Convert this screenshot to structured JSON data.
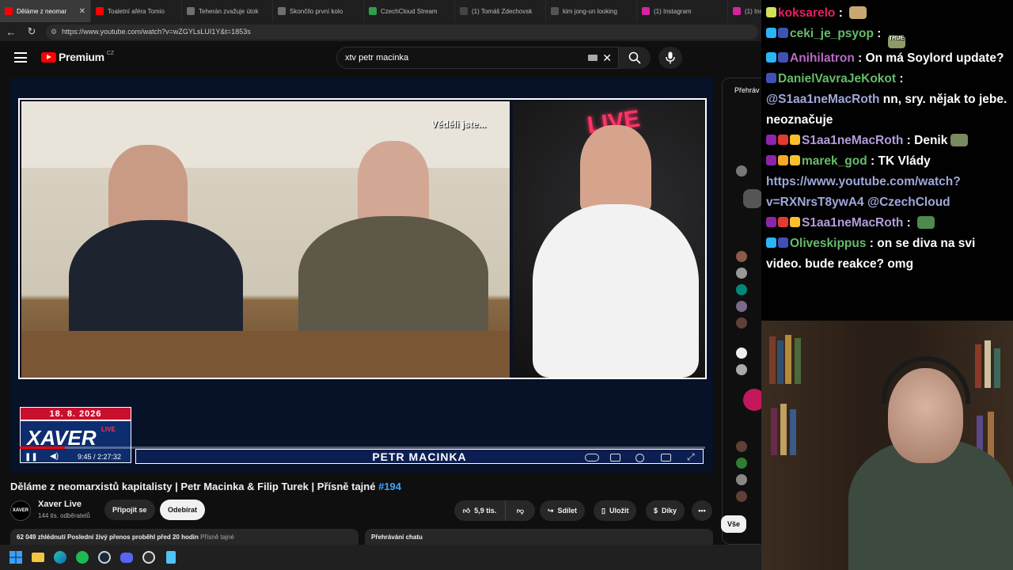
{
  "browser": {
    "tabs": [
      {
        "title": "Děláme z neomar",
        "active": true,
        "icon": "youtube-icon",
        "color": "#ff0000"
      },
      {
        "title": "Toaletní aféra Tomio",
        "active": false,
        "icon": "youtube-icon",
        "color": "#ff0000"
      },
      {
        "title": "Teherán zvažuje útok",
        "active": false,
        "icon": "page-icon",
        "color": "#6f6f6f"
      },
      {
        "title": "Skončilo první kolo",
        "active": false,
        "icon": "page-icon",
        "color": "#6f6f6f"
      },
      {
        "title": "CzechCloud Stream",
        "active": false,
        "icon": "green-icon",
        "color": "#2e9e4a"
      },
      {
        "title": "(1) Tomáš Zdechovsk",
        "active": false,
        "icon": "x-icon",
        "color": "#444444"
      },
      {
        "title": "kim jong-un looking",
        "active": false,
        "icon": "page-icon",
        "color": "#555555"
      },
      {
        "title": "(1) Instagram",
        "active": false,
        "icon": "instagram-icon",
        "color": "#d6249f"
      },
      {
        "title": "(1) Instag",
        "active": false,
        "icon": "instagram-icon",
        "color": "#d6249f"
      }
    ],
    "url": "https://www.youtube.com/watch?v=wZGYLsLUI1Y&t=1853s"
  },
  "youtube": {
    "logo_text": "Premium",
    "logo_region": "CZ",
    "search_value": "xtv petr macinka",
    "video": {
      "overlay_text": "Věděli jste...",
      "live_sign": "LIVE",
      "date": "18. 8. 2026",
      "brand": "XAVER",
      "brand_live": "LIVE",
      "time": "9:45 / 2:27:32",
      "name_bar": "PETR MACINKA",
      "progress": 0.066
    },
    "title": "Děláme z neomarxistů kapitalisty | Petr Macinka & Filip Turek | Přísně tajné",
    "title_tag": "#194",
    "channel": {
      "name": "Xaver Live",
      "subscribers": "144 tis. odběratelů",
      "avatar_text": "XAVER"
    },
    "buttons": {
      "join": "Připojit se",
      "unsubscribe": "Odebírat",
      "likes": "5,9 tis.",
      "share": "Sdílet",
      "save": "Uložit",
      "thanks": "Díky"
    },
    "description": {
      "views": "62 049 zhlédnutí",
      "stream_info": "Poslední živý přenos proběhl před 20 hodin",
      "tag": "Přísně tajné"
    },
    "chat_replay_label": "Přehrávání chatu",
    "side_header": "Přehráv",
    "side_filter": "Vše"
  },
  "twitch_chat": [
    {
      "user": "koksarelo",
      "color": "#e91e63",
      "text": "",
      "badges": [
        "#d4e157"
      ],
      "emote": "#c8a870"
    },
    {
      "user": "ceki_je_psyop",
      "color": "#66bb6a",
      "text": "",
      "badges": [
        "#29b6f6",
        "#3f51b5"
      ],
      "emote": "#8d9a6a",
      "emote_label": "TRUE"
    },
    {
      "user": "Anihilatron",
      "color": "#ba68c8",
      "text": "On má Soylord update?",
      "badges": [
        "#29b6f6",
        "#3f51b5"
      ]
    },
    {
      "user": "DanielVavraJeKokot",
      "color": "#66bb6a",
      "text": "",
      "badges": [
        "#3f51b5"
      ]
    },
    {
      "user": "",
      "color": "#ffffff",
      "text": "@S1aa1neMacRoth nn, sry. nějak to jebe. neoznačuje",
      "mention": "@S1aa1neMacRoth",
      "rest": "nn, sry. nějak to jebe. neoznačuje"
    },
    {
      "user": "S1aa1neMacRoth",
      "color": "#b39ddb",
      "text": "Denik",
      "badges": [
        "#8e24aa",
        "#e53935",
        "#fbc02d"
      ],
      "emote": "#7a8a60"
    },
    {
      "user": "marek_god",
      "color": "#66bb6a",
      "text": "TK Vlády",
      "badges": [
        "#8e24aa",
        "#f9a825",
        "#fbc02d"
      ],
      "link": "https://www.youtube.com/watch?v=RXNrsT8ywA4",
      "mention2": "@CzechCloud"
    },
    {
      "user": "S1aa1neMacRoth",
      "color": "#b39ddb",
      "text": "",
      "badges": [
        "#8e24aa",
        "#e53935",
        "#fbc02d"
      ],
      "emote": "#4e8a4e"
    },
    {
      "user": "Oliveskippus",
      "color": "#66bb6a",
      "text": "on se diva na svi video. bude reakce? omg",
      "badges": [
        "#29b6f6",
        "#3f51b5"
      ]
    }
  ],
  "colors": {
    "accent": "#3ea6ff",
    "yt_red": "#ff0000",
    "bg": "#0f0f0f"
  }
}
